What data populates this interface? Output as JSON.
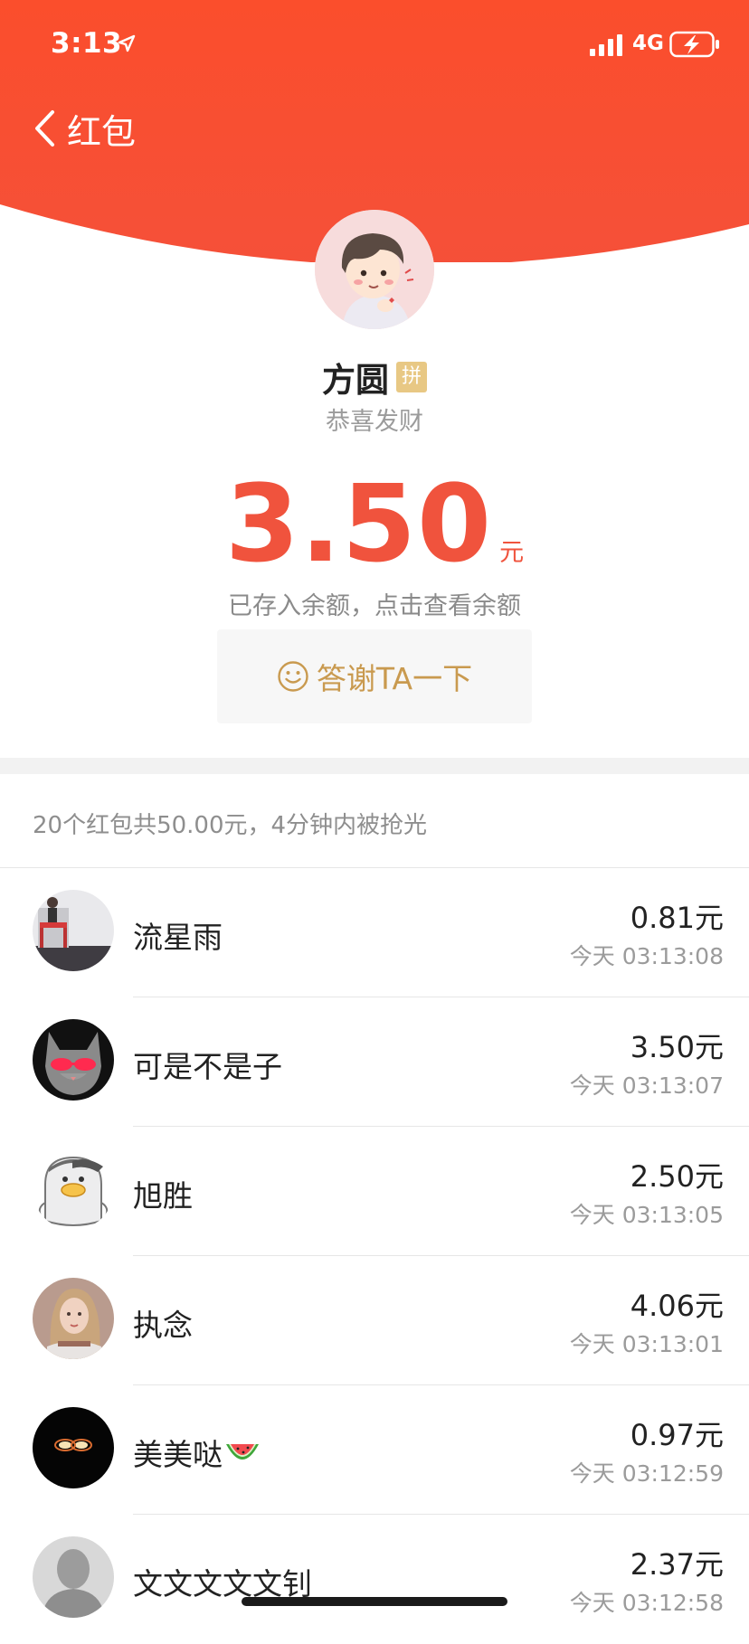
{
  "status_bar": {
    "time": "3:13",
    "network": "4G"
  },
  "nav": {
    "back_label": "红包"
  },
  "sender": {
    "name": "方圆",
    "badge": "拼",
    "greeting": "恭喜发财"
  },
  "received": {
    "amount": "3.50",
    "unit": "元",
    "balance_note": "已存入余额，点击查看余额",
    "thanks_label": "答谢TA一下"
  },
  "summary": "20个红包共50.00元，4分钟内被抢光",
  "records": [
    {
      "name": "流星雨",
      "amount": "0.81元",
      "time": "今天 03:13:08",
      "avatar_icon": "avatar-photo-icon"
    },
    {
      "name": "可是不是子",
      "amount": "3.50元",
      "time": "今天 03:13:07",
      "avatar_icon": "cat-sunglasses-icon"
    },
    {
      "name": "旭胜",
      "amount": "2.50元",
      "time": "今天 03:13:05",
      "avatar_icon": "duck-icon"
    },
    {
      "name": "执念",
      "amount": "4.06元",
      "time": "今天 03:13:01",
      "avatar_icon": "avatar-photo-icon"
    },
    {
      "name": "美美哒",
      "amount": "0.97元",
      "time": "今天 03:12:59",
      "avatar_icon": "glowing-eyes-icon"
    },
    {
      "name": "文文文文文钊",
      "amount": "2.37元",
      "time": "今天 03:12:58",
      "avatar_icon": "blurred-avatar-icon"
    }
  ],
  "colors": {
    "header": "#f84e30",
    "amount": "#f0533d",
    "thanks": "#c99a4f",
    "badge": "#e8c884"
  }
}
